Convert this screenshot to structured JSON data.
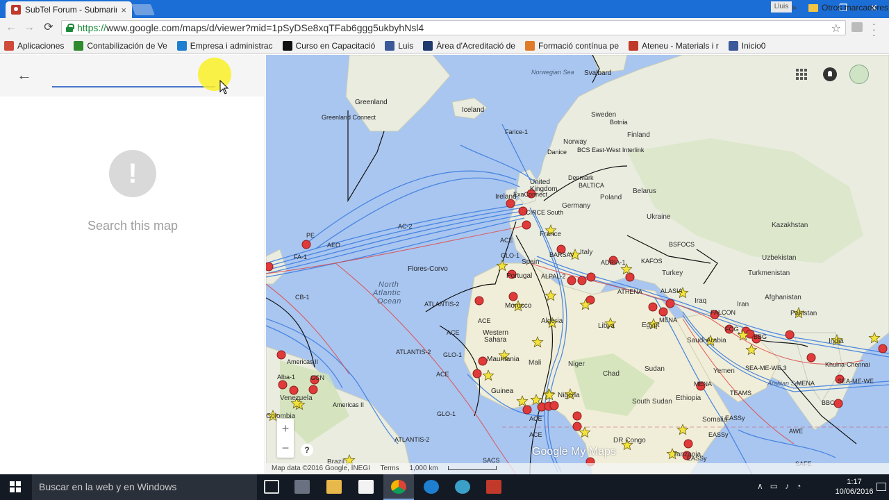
{
  "browser": {
    "tab_title": "SubTel Forum - Submarine",
    "tab_close": "×",
    "user_chip": "Lluis",
    "window_controls": {
      "minimize": "–",
      "restore": "❐",
      "close": "✕"
    },
    "url_scheme": "https://",
    "url_rest": "www.google.com/maps/d/viewer?mid=1pSyDSe8xqTFab6ggg5ukbyhNsl4",
    "bookmarks": [
      {
        "label": "Aplicaciones",
        "color": "#d04a3a"
      },
      {
        "label": "Contabilización de Ve",
        "color": "#2e8b2e"
      },
      {
        "label": "Empresa i administrac",
        "color": "#1e7fd0"
      },
      {
        "label": "Curso en Capacitació",
        "color": "#111111"
      },
      {
        "label": "Luis",
        "color": "#3b5998"
      },
      {
        "label": "Àrea d'Acreditació de",
        "color": "#1f3a6d"
      },
      {
        "label": "Formació contínua pe",
        "color": "#e07b2a"
      },
      {
        "label": "Ateneu - Materials i r",
        "color": "#c0392b"
      },
      {
        "label": "Inicio0",
        "color": "#3b5998"
      }
    ],
    "bookmarks_more": "»",
    "other_bookmarks": "Otros marcadores"
  },
  "sidepanel": {
    "empty_message": "Search this map",
    "empty_icon": "!"
  },
  "map": {
    "labels": {
      "norwegian_sea": "Norwegian Sea",
      "svalbard": "Svalbard",
      "greenland": "Greenland",
      "greenland_connect": "Greenland Connect",
      "iceland": "Iceland",
      "farice": "Farice-1",
      "sweden": "Sweden",
      "bothnia": "Botnia",
      "finland": "Finland",
      "norway": "Norway",
      "danice": "Danice",
      "bcs": "BCS East-West Interlink",
      "denmark": "Denmark",
      "baltica": "BALTICA",
      "belarus": "Belarus",
      "united_kingdom": "United",
      "kingdom": "Kingdom",
      "ireland": "Ireland",
      "exa": "ExaConnect",
      "germany": "Germany",
      "poland": "Poland",
      "circe": "CIRCE South",
      "ukraine": "Ukraine",
      "kazakhstan": "Kazakhstan",
      "france": "France",
      "bsfocs": "BSFOCS",
      "ac2": "AC-2",
      "aeo": "AEO",
      "pe": "PE",
      "fa1": "FA-1",
      "ace": "ACE",
      "flores": "Flores-Corvo",
      "barsav": "BARSAV",
      "italy": "Italy",
      "adria": "ADRIA-1",
      "kafos": "KAFOS",
      "uzbekistan": "Uzbekistan",
      "spain": "Spain",
      "glo1": "GLO-1",
      "portugal": "Portugal",
      "alpal": "ALPAL-2",
      "turkey": "Turkey",
      "turkmenistan": "Turkmenistan",
      "north_atlantic": "North",
      "north_atlantic2": "Atlantic",
      "north_atlantic3": "Ocean",
      "cb1": "CB-1",
      "athena": "ATHENA",
      "alasia": "ALASIA",
      "afghanistan": "Afghanistan",
      "iraq": "Iraq",
      "iran": "Iran",
      "atlantis2": "ATLANTIS-2",
      "morocco": "Morocco",
      "falcon": "FALCON",
      "pakistan": "Pakistan",
      "algeria": "Algeria",
      "libya": "Libya",
      "egypt": "Egypt",
      "mena": "MENA",
      "fog": "FOG",
      "bbg": "BBG",
      "western_sahara": "Western",
      "western_sahara2": "Sahara",
      "saudi": "Saudi Arabia",
      "india": "India",
      "mauritania": "Mauritania",
      "mali": "Mali",
      "niger": "Niger",
      "chad": "Chad",
      "sudan": "Sudan",
      "seamewe": "SEA-ME-WE 3",
      "khulna": "Khulna-Chennai",
      "americas2": "Americas II",
      "venezuela": "Venezuela",
      "guinea": "Guinea",
      "nigeria": "Nigeria",
      "yemen": "Yemen",
      "arabian_sea": "Arabian Sea",
      "sea_me_we": "SEA-ME-WE",
      "aruba": "Alba-1",
      "gcn": "GCN",
      "south_sudan": "South Sudan",
      "ethiopia": "Ethiopia",
      "teams": "TEAMS",
      "colombia": "Colombia",
      "dr_congo": "DR Congo",
      "somalia": "Somalia",
      "eassy": "EASSy",
      "awe": "AWE",
      "brazil": "Brazil",
      "sacs": "SACS",
      "tanzania": "Tanzania",
      "safe": "SAFE"
    },
    "zoom_in": "+",
    "zoom_out": "−",
    "help": "?",
    "logo": "Google My Maps",
    "attribution": "Map data ©2016 Google, INEGI",
    "terms": "Terms",
    "scale": "1,000 km"
  },
  "taskbar": {
    "search_placeholder": "Buscar en la web y en Windows",
    "time": "1:17",
    "date": "10/06/2016"
  },
  "colors": {
    "titlebar": "#1b6ed6",
    "cable_blue": "#3f7fe0",
    "cable_red": "#e04b4b",
    "landing_point": "#e03a3a",
    "star": "#f3e23b"
  }
}
